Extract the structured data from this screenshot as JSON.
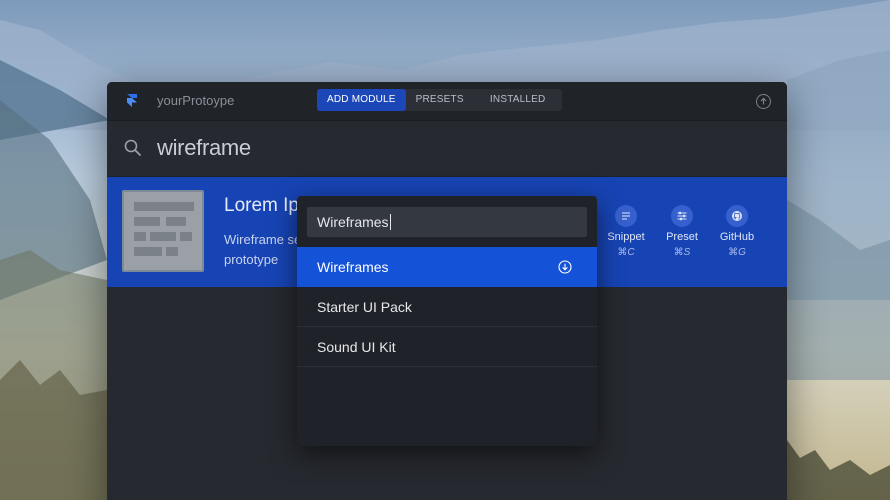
{
  "window": {
    "app_name": "yourProtoype",
    "tabs": [
      {
        "label": "ADD MODULE",
        "active": true
      },
      {
        "label": "PRESETS",
        "active": false
      },
      {
        "label": "INSTALLED",
        "active": false
      }
    ]
  },
  "search": {
    "query": "wireframe",
    "icon": "search-icon"
  },
  "result": {
    "title": "Lorem Ipsum",
    "description": "Wireframe set for your prototype",
    "actions": [
      {
        "label": "Snippet",
        "shortcut": "⌘C",
        "icon": "snippet-icon"
      },
      {
        "label": "Preset",
        "shortcut": "⌘S",
        "icon": "sliders-icon"
      },
      {
        "label": "GitHub",
        "shortcut": "⌘G",
        "icon": "github-icon"
      }
    ]
  },
  "dropdown": {
    "input_value": "Wireframes",
    "items": [
      {
        "label": "Wireframes",
        "selected": true
      },
      {
        "label": "Starter UI Pack",
        "selected": false
      },
      {
        "label": "Sound UI Kit",
        "selected": false
      }
    ]
  },
  "colors": {
    "accent": "#1744b4",
    "selected_item": "#1452d8",
    "window_bg": "#26292f"
  }
}
